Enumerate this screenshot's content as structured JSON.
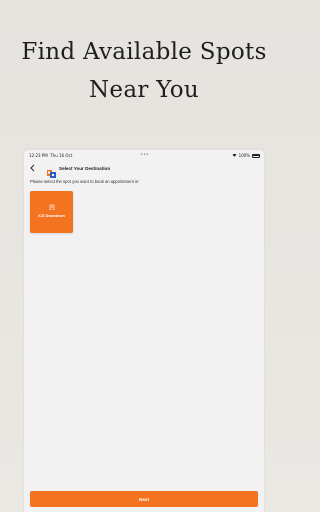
{
  "headline": {
    "line1": "Find Available Spots",
    "line2": "Near You"
  },
  "statusbar": {
    "time": "12:23 PM",
    "date": "Thu 16 Oct",
    "dots": "•••",
    "battery": "100%"
  },
  "navbar": {
    "back_icon": "chevron-left-icon",
    "title": "Select Your Destination"
  },
  "instruction": "Please select the spot you want to book an appointment in:",
  "tiles": [
    {
      "label": "ICS Downtown",
      "icon": "building-icon"
    }
  ],
  "next_button": {
    "label": "Next"
  },
  "colors": {
    "accent": "#f47320",
    "background": "#e8e5e1",
    "screen": "#f2f2f2"
  }
}
